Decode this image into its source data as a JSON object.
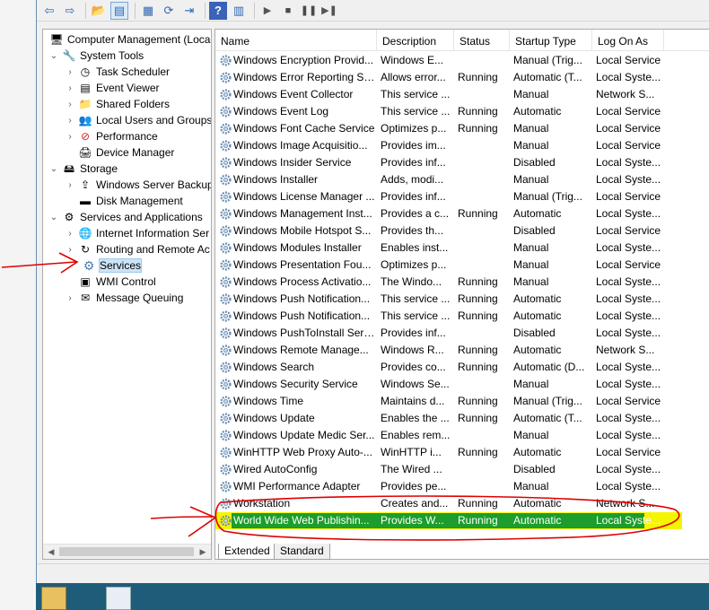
{
  "colors": {
    "selection": "#cce4f7",
    "highlight_yellow": "#f5f500",
    "highlight_green": "#1c9d2c",
    "annotation_red": "#e00000"
  },
  "toolbar": {
    "buttons": [
      "back-arrow-icon",
      "forward-arrow-icon",
      "up-folder-icon",
      "show-hide-tree-icon",
      "properties-icon",
      "refresh-icon",
      "export-list-icon",
      "help-icon",
      "action-pane-icon",
      "start-service-icon",
      "stop-service-icon",
      "pause-service-icon",
      "restart-service-icon"
    ]
  },
  "tree": {
    "nodes": [
      {
        "label": "Computer Management (Local",
        "icon": "computer-management-icon",
        "twisty": "",
        "level": 0
      },
      {
        "label": "System Tools",
        "icon": "tools-icon",
        "twisty": "down",
        "level": 1
      },
      {
        "label": "Task Scheduler",
        "icon": "clock-icon",
        "twisty": "right",
        "level": 2
      },
      {
        "label": "Event Viewer",
        "icon": "event-viewer-icon",
        "twisty": "right",
        "level": 2
      },
      {
        "label": "Shared Folders",
        "icon": "shared-folder-icon",
        "twisty": "right",
        "level": 2
      },
      {
        "label": "Local Users and Groups",
        "icon": "users-icon",
        "twisty": "right",
        "level": 2
      },
      {
        "label": "Performance",
        "icon": "performance-icon",
        "twisty": "right",
        "level": 2
      },
      {
        "label": "Device Manager",
        "icon": "device-manager-icon",
        "twisty": "",
        "level": 2
      },
      {
        "label": "Storage",
        "icon": "storage-icon",
        "twisty": "down",
        "level": 1
      },
      {
        "label": "Windows Server Backup",
        "icon": "backup-icon",
        "twisty": "right",
        "level": 2
      },
      {
        "label": "Disk Management",
        "icon": "disk-icon",
        "twisty": "",
        "level": 2
      },
      {
        "label": "Services and Applications",
        "icon": "services-apps-icon",
        "twisty": "down",
        "level": 1
      },
      {
        "label": "Internet Information Ser",
        "icon": "iis-icon",
        "twisty": "right",
        "level": 2
      },
      {
        "label": "Routing and Remote Ac",
        "icon": "routing-icon",
        "twisty": "right",
        "level": 2
      },
      {
        "label": "Services",
        "icon": "gear-icon",
        "twisty": "",
        "level": 2,
        "selected": true
      },
      {
        "label": "WMI Control",
        "icon": "wmi-icon",
        "twisty": "",
        "level": 2
      },
      {
        "label": "Message Queuing",
        "icon": "message-queue-icon",
        "twisty": "right",
        "level": 2
      }
    ]
  },
  "list": {
    "columns": [
      "Name",
      "Description",
      "Status",
      "Startup Type",
      "Log On As"
    ],
    "rows": [
      [
        "Windows Encryption Provid...",
        "Windows E...",
        "",
        "Manual (Trig...",
        "Local Service"
      ],
      [
        "Windows Error Reporting Se...",
        "Allows error...",
        "Running",
        "Automatic (T...",
        "Local Syste..."
      ],
      [
        "Windows Event Collector",
        "This service ...",
        "",
        "Manual",
        "Network S..."
      ],
      [
        "Windows Event Log",
        "This service ...",
        "Running",
        "Automatic",
        "Local Service"
      ],
      [
        "Windows Font Cache Service",
        "Optimizes p...",
        "Running",
        "Manual",
        "Local Service"
      ],
      [
        "Windows Image Acquisitio...",
        "Provides im...",
        "",
        "Manual",
        "Local Service"
      ],
      [
        "Windows Insider Service",
        "Provides inf...",
        "",
        "Disabled",
        "Local Syste..."
      ],
      [
        "Windows Installer",
        "Adds, modi...",
        "",
        "Manual",
        "Local Syste..."
      ],
      [
        "Windows License Manager ...",
        "Provides inf...",
        "",
        "Manual (Trig...",
        "Local Service"
      ],
      [
        "Windows Management Inst...",
        "Provides a c...",
        "Running",
        "Automatic",
        "Local Syste..."
      ],
      [
        "Windows Mobile Hotspot S...",
        "Provides th...",
        "",
        "Disabled",
        "Local Service"
      ],
      [
        "Windows Modules Installer",
        "Enables inst...",
        "",
        "Manual",
        "Local Syste..."
      ],
      [
        "Windows Presentation Fou...",
        "Optimizes p...",
        "",
        "Manual",
        "Local Service"
      ],
      [
        "Windows Process Activatio...",
        "The Windo...",
        "Running",
        "Manual",
        "Local Syste..."
      ],
      [
        "Windows Push Notification...",
        "This service ...",
        "Running",
        "Automatic",
        "Local Syste..."
      ],
      [
        "Windows Push Notification...",
        "This service ...",
        "Running",
        "Automatic",
        "Local Syste..."
      ],
      [
        "Windows PushToInstall Serv...",
        "Provides inf...",
        "",
        "Disabled",
        "Local Syste..."
      ],
      [
        "Windows Remote Manage...",
        "Windows R...",
        "Running",
        "Automatic",
        "Network S..."
      ],
      [
        "Windows Search",
        "Provides co...",
        "Running",
        "Automatic (D...",
        "Local Syste..."
      ],
      [
        "Windows Security Service",
        "Windows Se...",
        "",
        "Manual",
        "Local Syste..."
      ],
      [
        "Windows Time",
        "Maintains d...",
        "Running",
        "Manual (Trig...",
        "Local Service"
      ],
      [
        "Windows Update",
        "Enables the ...",
        "Running",
        "Automatic (T...",
        "Local Syste..."
      ],
      [
        "Windows Update Medic Ser...",
        "Enables rem...",
        "",
        "Manual",
        "Local Syste..."
      ],
      [
        "WinHTTP Web Proxy Auto-...",
        "WinHTTP i...",
        "Running",
        "Automatic",
        "Local Service"
      ],
      [
        "Wired AutoConfig",
        "The Wired ...",
        "",
        "Disabled",
        "Local Syste..."
      ],
      [
        "WMI Performance Adapter",
        "Provides pe...",
        "",
        "Manual",
        "Local Syste..."
      ],
      [
        "Workstation",
        "Creates and...",
        "Running",
        "Automatic",
        "Network S..."
      ],
      [
        "World Wide Web Publishin...",
        "Provides W...",
        "Running",
        "Automatic",
        "Local Syste..."
      ]
    ],
    "highlighted_row": 27
  },
  "tabs": [
    "Extended",
    "Standard"
  ]
}
